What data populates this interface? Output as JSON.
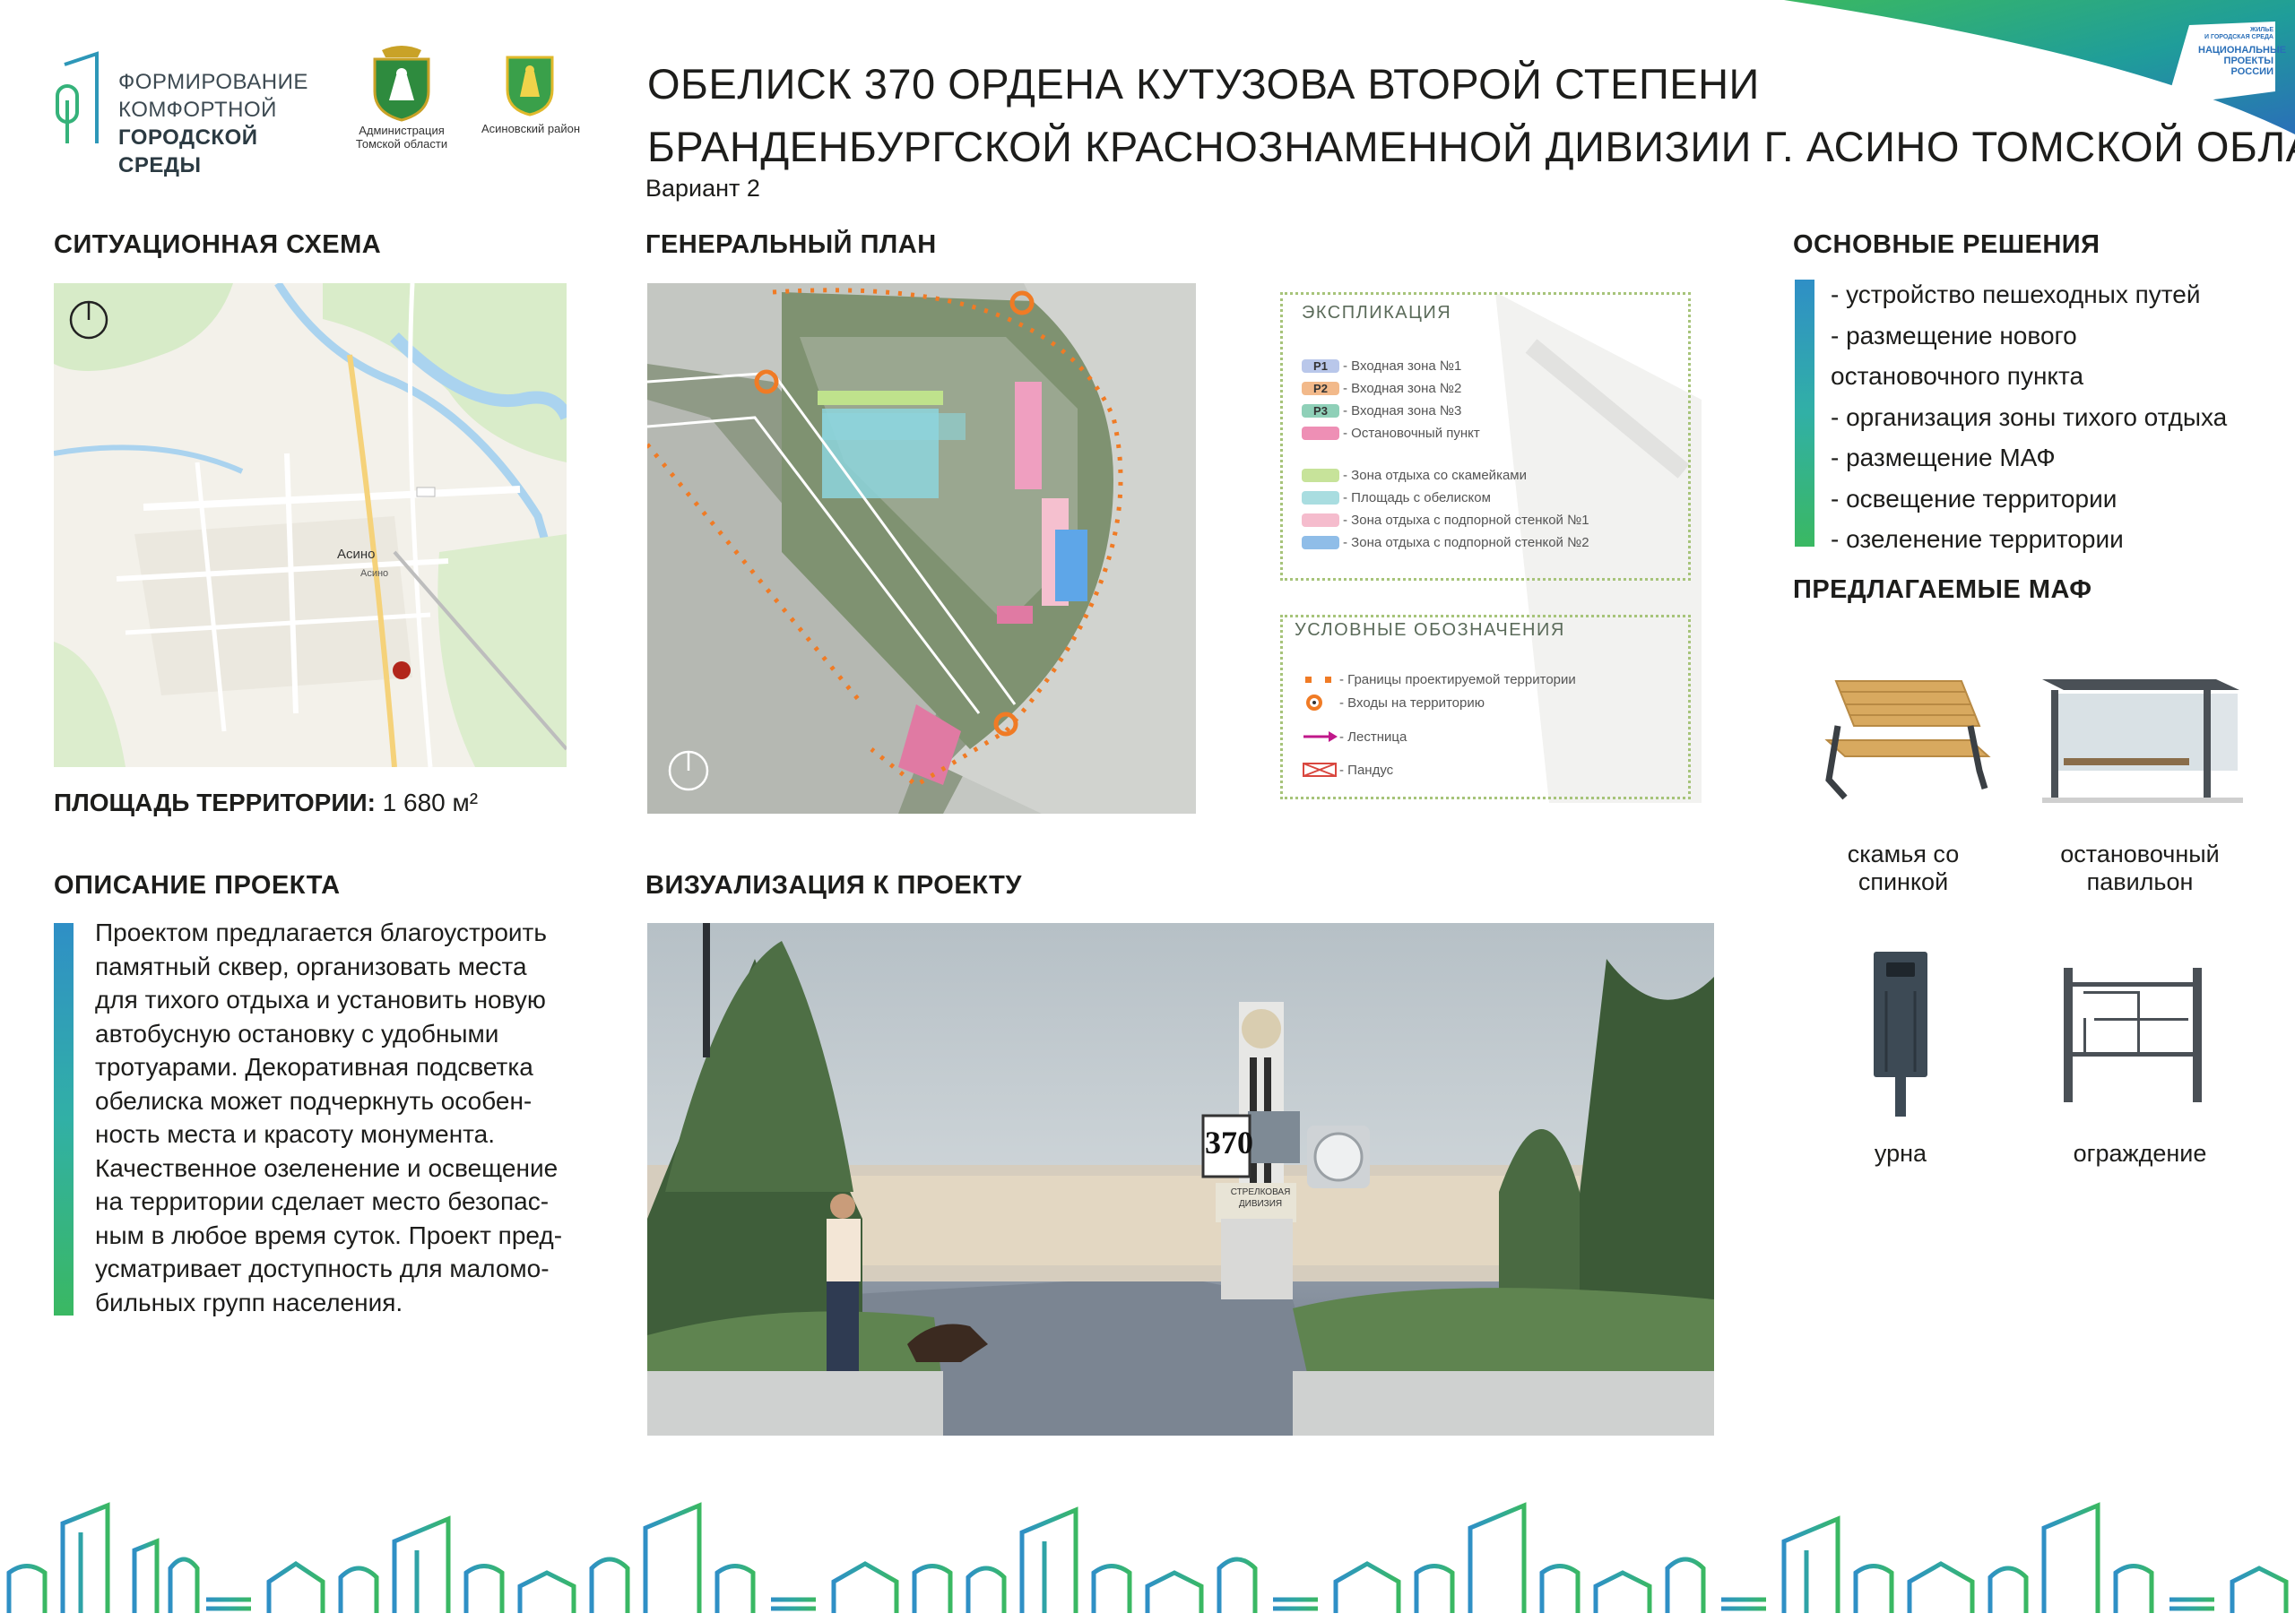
{
  "header": {
    "logo_line1": "Формирование",
    "logo_line2": "комфортной",
    "logo_line3": "городской среды",
    "emblem1_caption_l1": "Администрация",
    "emblem1_caption_l2": "Томской области",
    "emblem2_caption": "Асиновский район",
    "title_line1": "ОБЕЛИСК 370 ОРДЕНА КУТУЗОВА ВТОРОЙ СТЕПЕНИ",
    "title_line2": "БРАНДЕНБУРГСКОЙ КРАСНОЗНАМЕННОЙ ДИВИЗИИ Г. АСИНО ТОМСКОЙ ОБЛАСТИ",
    "variant": "Вариант 2",
    "np_badge_l1": "ЖИЛЬЕ",
    "np_badge_l2": "И ГОРОДСКАЯ СРЕДА",
    "np_badge_l3": "НАЦИОНАЛЬНЫЕ",
    "np_badge_l4": "ПРОЕКТЫ",
    "np_badge_l5": "РОССИИ"
  },
  "situation": {
    "title": "СИТУАЦИОННАЯ СХЕМА",
    "city_label": "Асино",
    "station_label": "Асино",
    "area_label": "ПЛОЩАДЬ ТЕРРИТОРИИ:",
    "area_value": "1 680 м²"
  },
  "general_plan": {
    "title": "ГЕНЕРАЛЬНЫЙ ПЛАН"
  },
  "explication": {
    "title": "ЭКСПЛИКАЦИЯ",
    "items": [
      {
        "code": "P1",
        "label": "- Входная зона №1",
        "color": "#b9c7ea"
      },
      {
        "code": "P2",
        "label": "- Входная зона №2",
        "color": "#f2b98a"
      },
      {
        "code": "P3",
        "label": "- Входная зона №3",
        "color": "#8fd0b8"
      },
      {
        "code": "",
        "label": "- Остановочный пункт",
        "color": "#ee8fb5"
      },
      {
        "code": "",
        "label": "- Зона отдыха со скамейками",
        "color": "#c7e39a"
      },
      {
        "code": "",
        "label": "- Площадь с обелиском",
        "color": "#a9dde0"
      },
      {
        "code": "",
        "label": "- Зона отдыха с подпорной стенкой №1",
        "color": "#f5bccd"
      },
      {
        "code": "",
        "label": "- Зона отдыха с подпорной стенкой №2",
        "color": "#8fbde8"
      }
    ]
  },
  "symbols": {
    "title": "УСЛОВНЫЕ ОБОЗНАЧЕНИЯ",
    "items": [
      {
        "label": "- Границы проектируемой территории"
      },
      {
        "label": "- Входы на территорию"
      },
      {
        "label": "- Лестница"
      },
      {
        "label": "- Пандус"
      }
    ]
  },
  "solutions": {
    "title": "ОСНОВНЫЕ РЕШЕНИЯ",
    "lines": [
      "- устройство пешеходных путей",
      "- размещение нового",
      "остановочного пункта",
      "- организация зоны тихого отдыха",
      "- размещение МАФ",
      "- освещение территории",
      "- озеленение территории"
    ]
  },
  "maf": {
    "title": "ПРЕДЛАГАЕМЫЕ МАФ",
    "items": [
      {
        "l1": "скамья со",
        "l2": "спинкой"
      },
      {
        "l1": "остановочный",
        "l2": "павильон"
      },
      {
        "l1": "урна",
        "l2": ""
      },
      {
        "l1": "ограждение",
        "l2": ""
      }
    ]
  },
  "description": {
    "title": "ОПИСАНИЕ ПРОЕКТА",
    "lines": [
      "Проектом предлагается благоустроить",
      "памятный сквер, организовать места",
      "для тихого отдыха и установить новую",
      "автобусную остановку с удобными",
      "тротуарами. Декоративная подсветка",
      "обелиска может подчеркнуть особен-",
      "ность места и красоту монумента.",
      "Качественное озеленение и освещение",
      "на территории сделает место безопас-",
      "ным в любое время суток. Проект пред-",
      "усматривает доступность для маломо-",
      "бильных групп населения."
    ]
  },
  "visualization": {
    "title": "ВИЗУАЛИЗАЦИЯ К ПРОЕКТУ",
    "obelisk_number": "370",
    "plaque_l1": "СТРЕЛКОВАЯ",
    "plaque_l2": "ДИВИЗИЯ"
  },
  "colors": {
    "accent_blue": "#2f8fc6",
    "accent_green": "#3ab862",
    "brand_teal": "#1f9d9a"
  }
}
